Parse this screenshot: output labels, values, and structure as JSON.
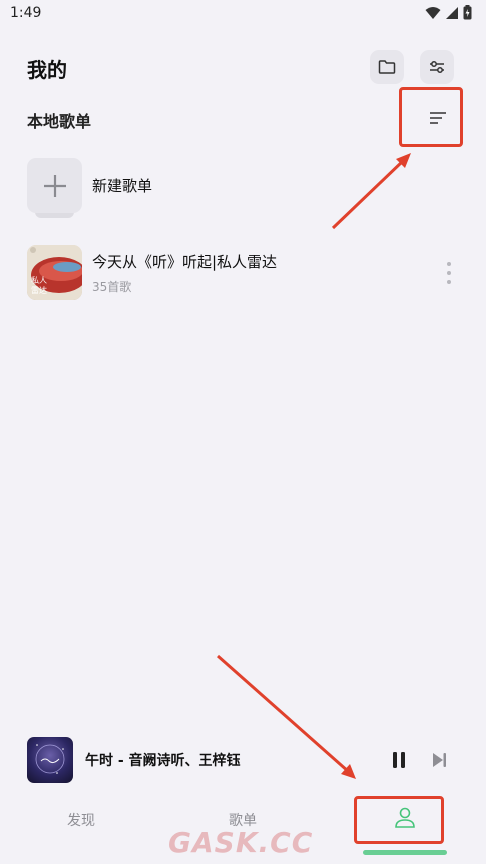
{
  "status_bar": {
    "time": "1:49"
  },
  "header": {
    "title": "我的"
  },
  "section": {
    "title": "本地歌单"
  },
  "new_playlist": {
    "label": "新建歌单"
  },
  "playlists": [
    {
      "title": "今天从《听》听起|私人雷达",
      "subtitle": "35首歌",
      "cover_text": "私人\n雷达"
    }
  ],
  "mini_player": {
    "title": "午时 - 音阙诗听、王梓钰"
  },
  "tabs": [
    {
      "label": "发现"
    },
    {
      "label": "歌单"
    },
    {
      "label": "我的",
      "active": true
    }
  ],
  "watermark": {
    "text": "GASK.CC"
  },
  "colors": {
    "accent": "#46c47a",
    "annotation": "#e0412c",
    "background": "#f3f2f7"
  }
}
